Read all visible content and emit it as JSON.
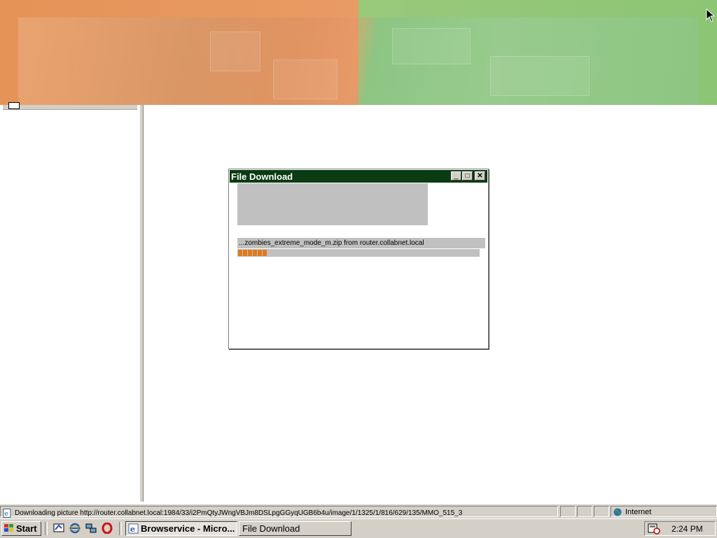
{
  "dialog": {
    "title": "File Download",
    "file_line": "...zombies_extreme_mode_m.zip from router.collabnet.local",
    "progress_blocks": 6,
    "buttons": {
      "minimize": "_",
      "maximize": "□",
      "close": "✕"
    }
  },
  "statusbar": {
    "text": "Downloading picture http://router.collabnet.local:1984/33/i2PmQtyJWngVBJm8DSLpgGGyqUGB6b4u/image/1/1325/1/816/629/135/MMO_515_3",
    "zone": "Internet"
  },
  "taskbar": {
    "start_label": "Start",
    "tasks": [
      {
        "label": "Browservice - Micro...",
        "active": true
      },
      {
        "label": "File Download",
        "active": false
      }
    ],
    "quick_launch": [
      "show-desktop-icon",
      "internet-explorer-icon",
      "network-icon",
      "opera-icon"
    ],
    "clock": "2:24 PM"
  },
  "colors": {
    "banner_orange": "#e59357",
    "banner_green": "#8cc573",
    "dialog_title": "#0a3b12",
    "progress": "#e07a1a"
  }
}
